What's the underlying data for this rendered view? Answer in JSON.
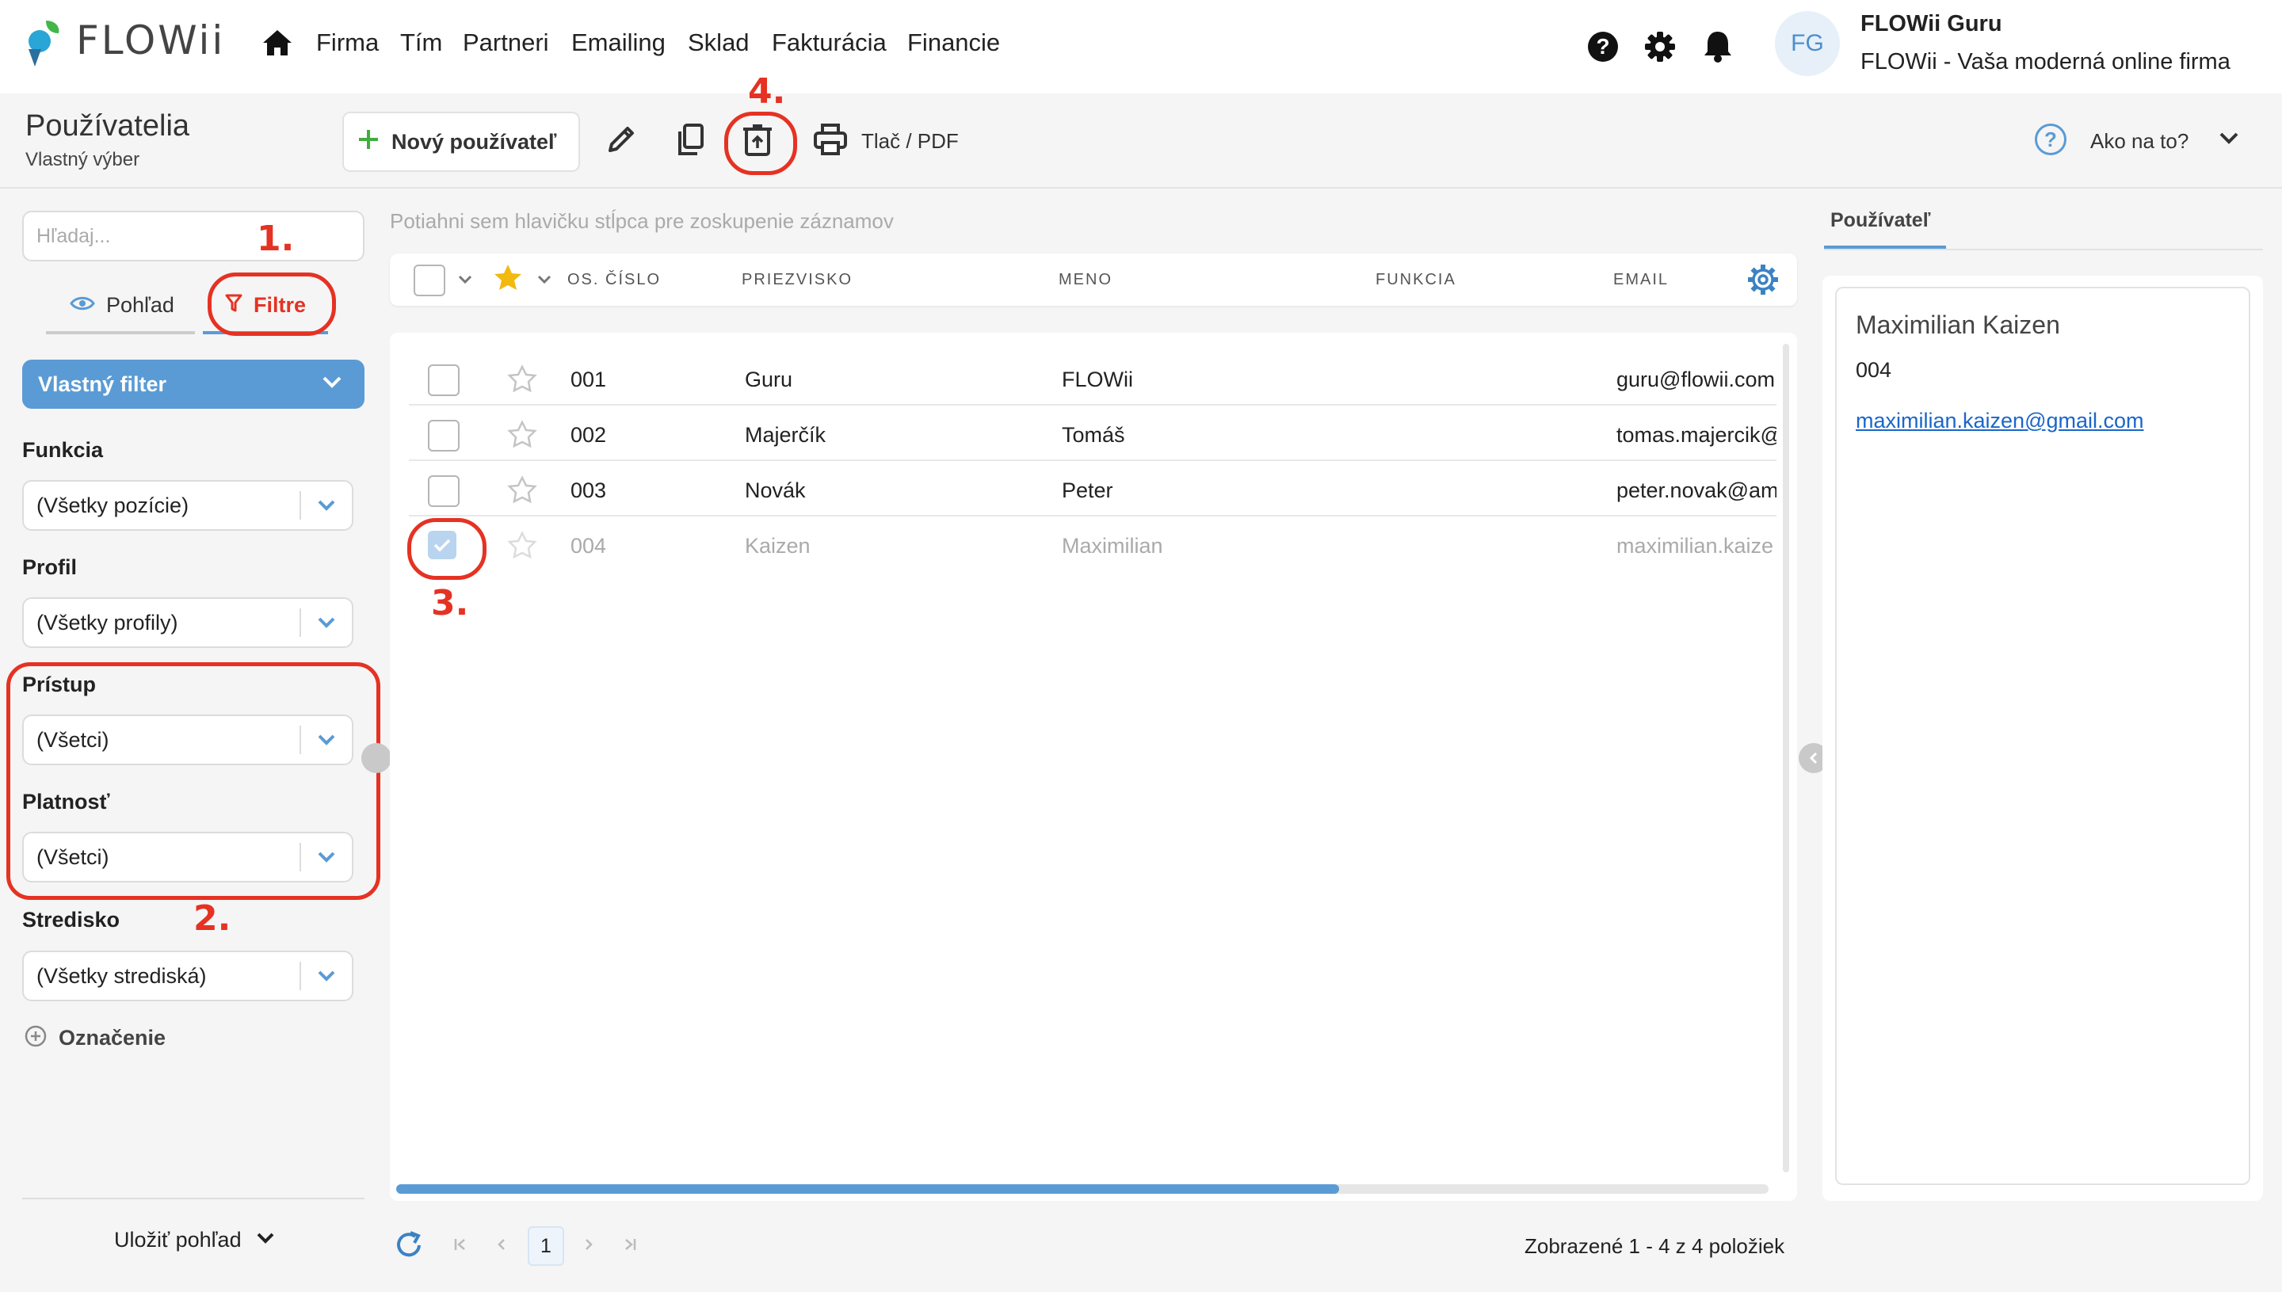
{
  "nav": {
    "logo_text": "FLOWii",
    "items": [
      "Firma",
      "Tím",
      "Partneri",
      "Emailing",
      "Sklad",
      "Fakturácia",
      "Financie"
    ],
    "avatar_initials": "FG",
    "user_name": "FLOWii Guru",
    "company": "FLOWii - Vaša moderná online firma"
  },
  "page": {
    "title": "Používatelia",
    "subtitle": "Vlastný výber"
  },
  "toolbar": {
    "new_user_label": "Nový používateľ",
    "print_label": "Tlač / PDF",
    "help_label": "Ako na to?"
  },
  "annotations": [
    "1.",
    "2.",
    "3.",
    "4."
  ],
  "sidebar": {
    "search_placeholder": "Hľadaj...",
    "tab_view": "Pohľad",
    "tab_filters": "Filtre",
    "custom_filter": "Vlastný filter",
    "filters": [
      {
        "label": "Funkcia",
        "value": "(Všetky pozície)"
      },
      {
        "label": "Profil",
        "value": "(Všetky profily)"
      },
      {
        "label": "Prístup",
        "value": "(Všetci)"
      },
      {
        "label": "Platnosť",
        "value": "(Všetci)"
      },
      {
        "label": "Stredisko",
        "value": "(Všetky strediská)"
      }
    ],
    "add_tag": "Označenie",
    "save_view": "Uložiť pohľad"
  },
  "grid": {
    "group_hint": "Potiahni sem hlavičku stĺpca pre zoskupenie záznamov",
    "columns": [
      "OS. ČÍSLO",
      "PRIEZVISKO",
      "MENO",
      "FUNKCIA",
      "EMAIL"
    ],
    "rows": [
      {
        "num": "001",
        "surname": "Guru",
        "name": "FLOWii",
        "role": "",
        "email": "guru@flowii.com",
        "checked": false
      },
      {
        "num": "002",
        "surname": "Majerčík",
        "name": "Tomáš",
        "role": "",
        "email": "tomas.majercik@",
        "checked": false
      },
      {
        "num": "003",
        "surname": "Novák",
        "name": "Peter",
        "role": "",
        "email": "peter.novak@am",
        "checked": false
      },
      {
        "num": "004",
        "surname": "Kaizen",
        "name": "Maximilian",
        "role": "",
        "email": "maximilian.kaize",
        "checked": true
      }
    ],
    "pager_page": "1",
    "summary": "Zobrazené 1 - 4 z 4 položiek"
  },
  "detail": {
    "tab": "Používateľ",
    "name": "Maximilian Kaizen",
    "number": "004",
    "email": "maximilian.kaizen@gmail.com"
  },
  "colors": {
    "accent_blue": "#5a9bd5",
    "annotation_red": "#e53223",
    "star_yellow": "#f2b90f",
    "green_plus": "#3fae3b"
  }
}
